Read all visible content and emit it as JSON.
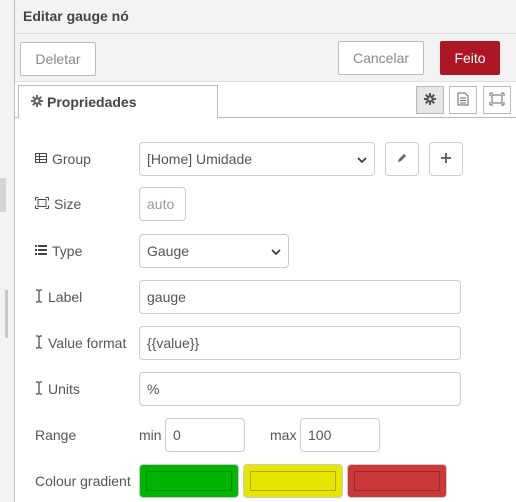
{
  "tray": {
    "title": "Editar gauge nó"
  },
  "toolbar": {
    "delete_label": "Deletar",
    "cancel_label": "Cancelar",
    "done_label": "Feito"
  },
  "tabs": {
    "properties_label": "Propriedades"
  },
  "form": {
    "group": {
      "label": "Group",
      "value": "[Home] Umidade"
    },
    "size": {
      "label": "Size",
      "value": "auto"
    },
    "type": {
      "label": "Type",
      "value": "Gauge"
    },
    "label_field": {
      "label": "Label",
      "value": "gauge"
    },
    "value_format": {
      "label": "Value format",
      "value": "{{value}}"
    },
    "units": {
      "label": "Units",
      "value": "%"
    },
    "range": {
      "label": "Range",
      "min_label": "min",
      "min_value": "0",
      "max_label": "max",
      "max_value": "100"
    },
    "colour_gradient": {
      "label": "Colour gradient",
      "colors": [
        "#00b500",
        "#e6e600",
        "#ca3838"
      ]
    }
  },
  "icons": {
    "tab": "gear-icon",
    "group": "table-icon",
    "size": "resize-icon",
    "type": "list-icon",
    "label": "text-cursor-icon",
    "value_format": "text-cursor-icon",
    "units": "text-cursor-icon",
    "edit": "pencil-icon",
    "add": "plus-icon",
    "info": "document-icon",
    "appearance": "frame-icon",
    "dropdown": "chevron-down-icon"
  },
  "colors": {
    "accent": "#ad1625",
    "border": "#bbbbbb",
    "background": "#f3f3f3"
  }
}
